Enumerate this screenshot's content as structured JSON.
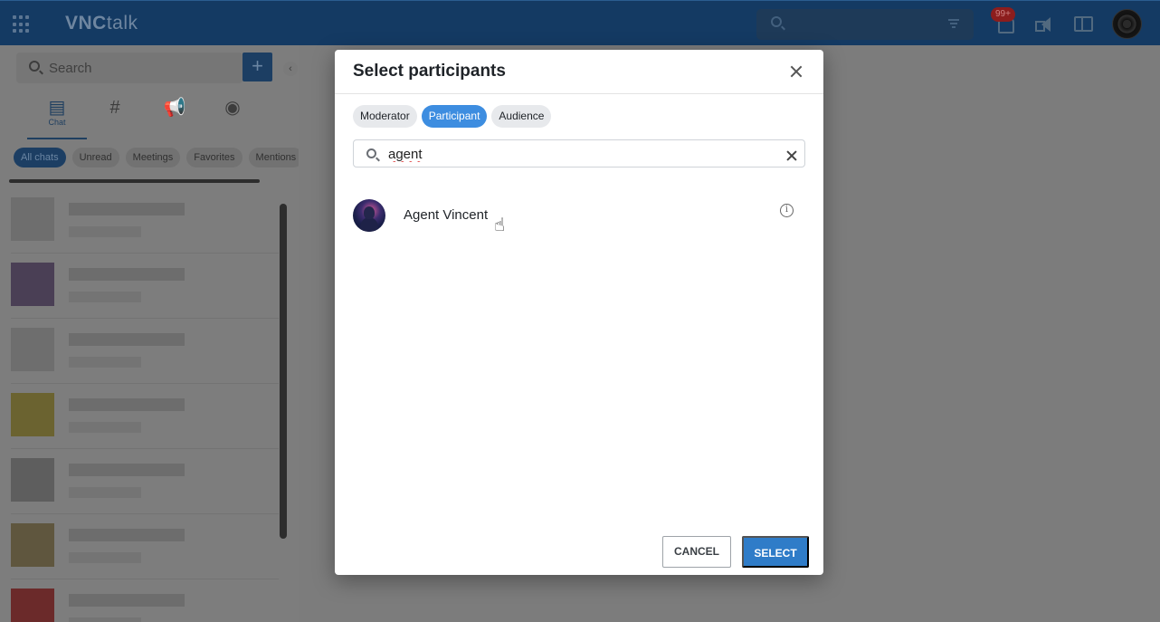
{
  "app": {
    "logo_bold": "VNC",
    "logo_light": "talk",
    "notifications_badge": "99+"
  },
  "sidebar": {
    "search_placeholder": "Search",
    "add_label": "+",
    "tabs": [
      {
        "label": "Chat",
        "icon": "chat-icon"
      },
      {
        "label": "",
        "icon": "channel-hash-icon"
      },
      {
        "label": "",
        "icon": "broadcast-icon"
      },
      {
        "label": "",
        "icon": "contacts-icon"
      }
    ],
    "filters": [
      "All chats",
      "Unread",
      "Meetings",
      "Favorites",
      "Mentions"
    ]
  },
  "dialog": {
    "title": "Select participants",
    "role_tabs": [
      "Moderator",
      "Participant",
      "Audience"
    ],
    "active_role": "Participant",
    "search_value": "agent",
    "results": [
      {
        "name": "Agent Vincent"
      }
    ],
    "cancel_label": "CANCEL",
    "select_label": "SELECT"
  },
  "colors": {
    "primary": "#2f7cc8",
    "active_tab": "#3d8de0",
    "topbar": "#143a63"
  }
}
